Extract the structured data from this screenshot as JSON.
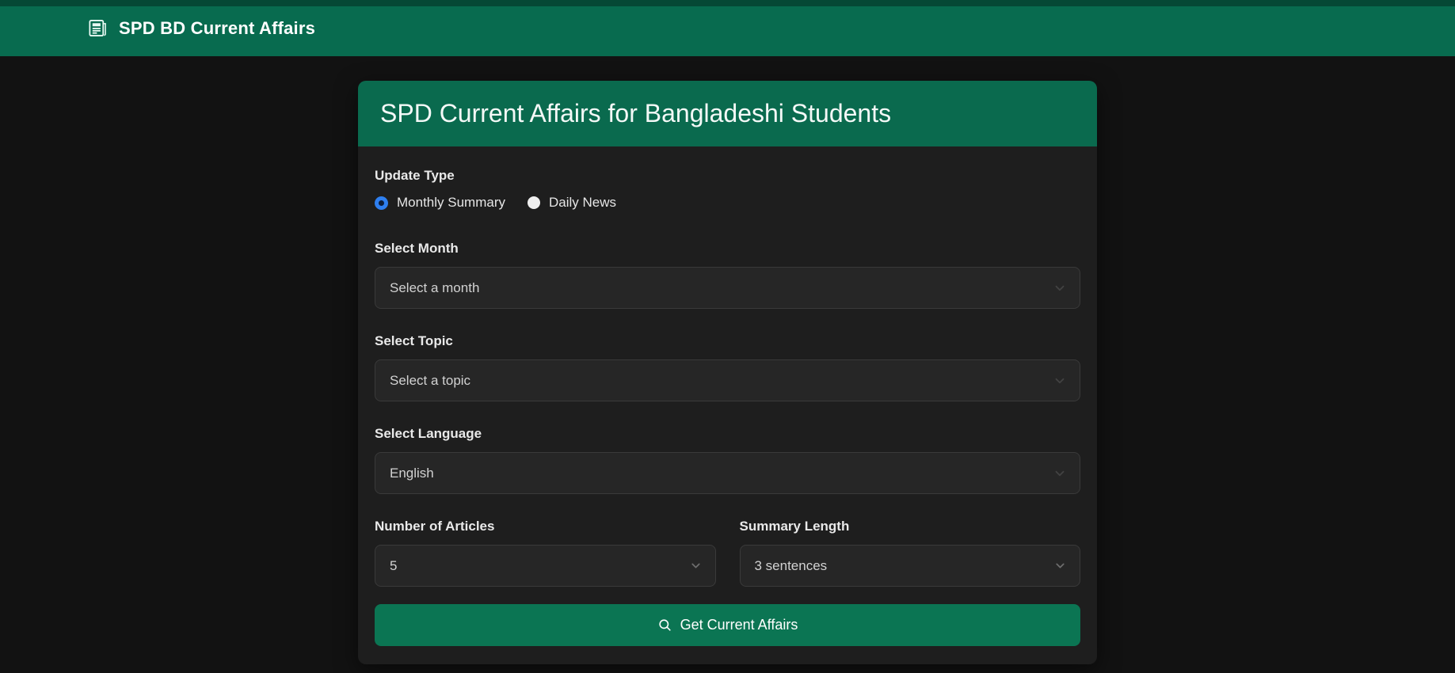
{
  "topbar": {
    "title": "SPD BD Current Affairs",
    "icon": "newspaper-icon",
    "bg_color": "#086b4f"
  },
  "card": {
    "title": "SPD Current Affairs for Bangladeshi Students",
    "header_bg_color": "#0a6a4e",
    "update_type": {
      "label": "Update Type",
      "options": [
        {
          "label": "Monthly Summary",
          "selected": true
        },
        {
          "label": "Daily News",
          "selected": false
        }
      ],
      "selected_color": "#2e7ff0"
    },
    "month": {
      "label": "Select Month",
      "value": "Select a month"
    },
    "topic": {
      "label": "Select Topic",
      "value": "Select a topic"
    },
    "language": {
      "label": "Select Language",
      "value": "English"
    },
    "articles": {
      "label": "Number of Articles",
      "value": "5"
    },
    "summary_length": {
      "label": "Summary Length",
      "value": "3 sentences"
    },
    "submit": {
      "label": "Get Current Affairs",
      "icon": "search-icon",
      "bg_color": "#0b7553"
    }
  }
}
